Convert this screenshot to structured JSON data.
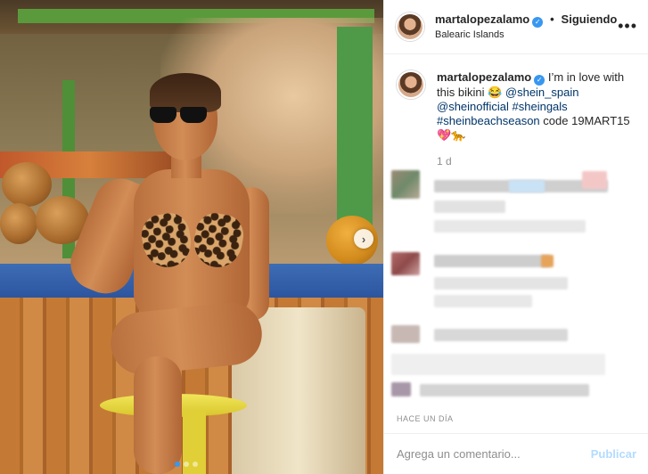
{
  "header": {
    "username": "martalopezalamo",
    "separator": "•",
    "follow_label": "Siguiendo",
    "location": "Balearic Islands",
    "more_label": "•••"
  },
  "caption": {
    "username": "martalopezalamo",
    "text": "I’m in love with this bikini 😂",
    "mention1": "@shein_spain",
    "mention2": "@sheinofficial",
    "hashtag1": "#sheingals",
    "hashtag2": "#sheinbeachseason",
    "code_text": "code 19MART15",
    "emoji_end": "💖🐆",
    "time": "1 d"
  },
  "carousel": {
    "next_label": "›",
    "slides_visible": 3
  },
  "post_date": "HACE UN DÍA",
  "add_comment": {
    "placeholder": "Agrega un comentario...",
    "publish_label": "Publicar"
  }
}
